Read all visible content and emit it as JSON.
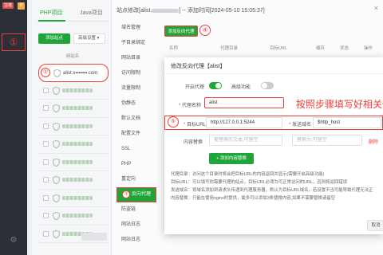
{
  "nav": {
    "brand": "宝塔",
    "badge": "0",
    "marker": "①",
    "gear_icon": "gear-icon"
  },
  "sites": {
    "tabs": [
      "PHP项目",
      "Java项目"
    ],
    "add_site": "添加站点",
    "advanced": "高级设置",
    "column": "网站名",
    "rows": [
      {
        "name": "alist.x▪▪▪▪▪▪▪.com",
        "highlight": true,
        "marker": "②"
      },
      {
        "name": "",
        "highlight": false
      },
      {
        "name": "",
        "highlight": false
      },
      {
        "name": "",
        "highlight": false
      },
      {
        "name": "",
        "highlight": false
      },
      {
        "name": "",
        "highlight": false
      },
      {
        "name": "",
        "highlight": false
      },
      {
        "name": "",
        "highlight": false
      },
      {
        "name": "",
        "highlight": false
      },
      {
        "name": "",
        "highlight": false
      }
    ]
  },
  "window": {
    "title_prefix": "站点修改[alist.",
    "title_suffix": "] -- 添加时间[2024-05-10 15:05:37]",
    "close": "×",
    "menu": [
      "域名管理",
      "子目录绑定",
      "网站目录",
      "访问限制",
      "流量限制",
      "伪静态",
      "默认文档",
      "配置文件",
      "SSL",
      "PHP",
      "重定向",
      "反向代理",
      "防盗链",
      "网站日志",
      "网站日志"
    ],
    "menu_active_index": 11,
    "menu_active_marker": "③",
    "add_proxy": "添加反向代理",
    "add_proxy_marker": "④",
    "headers": [
      "名称",
      "代理目录",
      "目标URL",
      "缓存",
      "状态",
      "操作"
    ]
  },
  "dialog": {
    "title": "修改反向代理【alist】",
    "enable_label": "开启代理",
    "advanced_label": "高级功能",
    "name_label": "代理名称",
    "name_value": "alist",
    "target_label": "目标URL",
    "target_value": "http://127.0.0.1:5244",
    "send_domain_label": "发送域名",
    "send_domain_value": "$http_host",
    "content_label": "内容替换",
    "content_ph1": "被替换的文本,可留空",
    "content_ph2": "替换为,可留空",
    "delete": "删除",
    "add_content": "添加内容替换",
    "row_marker": "⑤",
    "annotation": "按照步骤填写好相关信",
    "notes": [
      "代理目录：访问这个目录时将会把目标URL的内容返回并显示(需要开启高级功能)",
      "目标URL：可以填写你需要代理的站点，目标URL必须为可正常访问的URL，否则将返回错误",
      "发送域名：将域名添加到请求头传递到代理服务器，默认为目标URL域名，若设置不当可能导致代理无法正",
      "内容替换：只能在使用nginx时提供，最多可以添加3条替换内容,如果不需要替换请留空"
    ],
    "cancel": "取消"
  },
  "colors": {
    "green": "#20a53a",
    "red_annotation": "#e8413c",
    "nav_dark": "#2c2f36"
  }
}
